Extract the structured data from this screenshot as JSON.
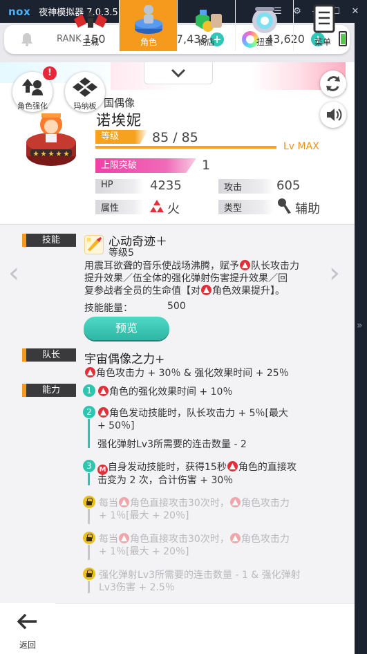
{
  "window": {
    "brand": "nox",
    "title": "夜神模拟器 7.0.3.5"
  },
  "status": {
    "rank_label": "RANK",
    "rank_value": "150",
    "coins": "66,367,438",
    "gems": "43,620"
  },
  "header": {
    "enhance_label": "角色强化",
    "enhance_badge": "!",
    "marnab_label": "玛纳板",
    "subtitle": "国偶像",
    "name": "诺埃妮",
    "level_label": "等级",
    "level_value": "85 / 85",
    "level_max": "Lv MAX",
    "limit_label": "上限突破",
    "limit_value": "1",
    "hp_label": "HP",
    "hp_value": "4235",
    "atk_label": "攻击",
    "atk_value": "605",
    "attr_label": "属性",
    "attr_value": "火",
    "type_label": "类型",
    "type_value": "辅助",
    "stars": 5
  },
  "skill": {
    "tag": "技能",
    "name": "心动奇迹＋",
    "level": "等级5",
    "desc_line1_a": "用震耳欲聋的音乐使战场沸腾，赋予",
    "desc_line1_b": "队长攻击力",
    "desc_line2": "提升效果／伍全体的强化弹射伤害提升效果／回",
    "desc_line3_a": "复参战者全员的生命值【对",
    "desc_line3_b": "角色效果提升】。",
    "energy_label": "技能能量：",
    "energy_value": "500",
    "preview_label": "预览"
  },
  "leader": {
    "tag": "队长",
    "name": "宇宙偶像之力+",
    "effect": "角色攻击力 + 30％ & 强化效果时间 + 25％"
  },
  "abilities": {
    "tag": "能力",
    "a1_num": "1",
    "a1_text": "角色的强化效果时间 + 10％",
    "a2_num": "2",
    "a2_line1": "角色发动技能时，队长攻击力 + 5％[最大",
    "a2_line2": "+ 50％]",
    "a2_line3": "强化弹射Lv3所需要的连击数量 - 2",
    "a3_num": "3",
    "a3_line1_a": "自身发动技能时，获得15秒",
    "a3_line1_b": "角色的直接攻",
    "a3_line2": "击变为 2 次，合计伤害 + 30％",
    "l1_line1_a": "每当",
    "l1_line1_b": "角色直接攻击30次时，",
    "l1_line1_c": "角色攻击力",
    "l1_line2": "+ 1％[最大 + 20％]",
    "l2_line1_a": "每当",
    "l2_line1_b": "角色直接攻击30次时，",
    "l2_line1_c": "角色攻击力",
    "l2_line2": "+ 1％[最大 + 20％]",
    "l3_line1": "强化弹射Lv3所需要的连击数量 - 1 & 强化弹射",
    "l3_line2": "Lv3伤害 + 2.5％"
  },
  "nav": {
    "back": "返回",
    "items": [
      "主城",
      "角色",
      "商店",
      "扭蛋",
      "菜单"
    ]
  },
  "colors": {
    "accent": "#f59a1c",
    "teal": "#2fc4b0",
    "fire": "#e0303a",
    "limit": "#f03fa6"
  }
}
